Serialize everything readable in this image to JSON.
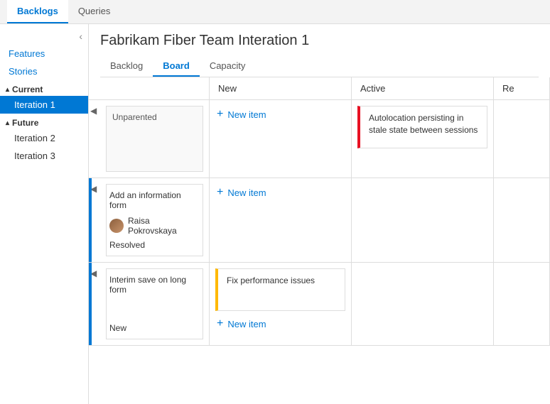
{
  "app": {
    "top_tabs": [
      {
        "label": "Backlogs",
        "active": true
      },
      {
        "label": "Queries",
        "active": false
      }
    ]
  },
  "sidebar": {
    "collapse_icon": "‹",
    "links": [
      {
        "label": "Features"
      },
      {
        "label": "Stories"
      }
    ],
    "sections": [
      {
        "label": "Current",
        "items": [
          {
            "label": "Iteration 1",
            "selected": true
          }
        ]
      },
      {
        "label": "Future",
        "items": [
          {
            "label": "Iteration 2",
            "selected": false
          },
          {
            "label": "Iteration 3",
            "selected": false
          }
        ]
      }
    ]
  },
  "content": {
    "title": "Fabrikam Fiber Team Interation 1",
    "tabs": [
      {
        "label": "Backlog",
        "active": false
      },
      {
        "label": "Board",
        "active": true
      },
      {
        "label": "Capacity",
        "active": false
      }
    ]
  },
  "board": {
    "columns": [
      {
        "label": ""
      },
      {
        "label": "New"
      },
      {
        "label": "Active"
      },
      {
        "label": "Re"
      }
    ],
    "rows": [
      {
        "label": "Unparented",
        "new_cell": {
          "new_item_label": "New item"
        },
        "active_cell": {
          "card": {
            "title": "Autolocation persisting in stale state between sessions",
            "accent": "red"
          }
        }
      },
      {
        "label": "Add an information form",
        "assignee": "Raisa Pokrovskaya",
        "status": "Resolved",
        "new_cell": {
          "new_item_label": "New item"
        },
        "active_cell": {}
      },
      {
        "label": "Interim save on long form",
        "status": "New",
        "new_cell": {
          "card": {
            "title": "Fix performance issues",
            "accent": "yellow"
          },
          "new_item_label": "New item"
        },
        "active_cell": {}
      }
    ],
    "new_item_label": "+ New item"
  }
}
